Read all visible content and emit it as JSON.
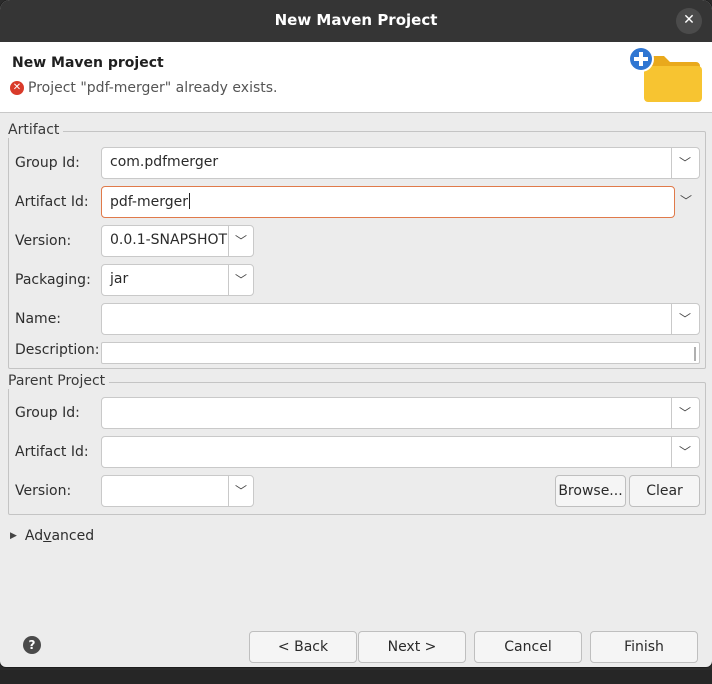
{
  "window": {
    "title": "New Maven Project",
    "close_glyph": "✕"
  },
  "header": {
    "title": "New Maven project",
    "message": "Project \"pdf-merger\" already exists.",
    "error_icon": "error-icon",
    "wizard_icon": "new-folder-icon"
  },
  "artifact": {
    "label": "Artifact",
    "group_id_label": "Group Id:",
    "group_id_value": "com.pdfmerger",
    "artifact_id_label": "Artifact Id:",
    "artifact_id_value": "pdf-merger",
    "version_label": "Version:",
    "version_value": "0.0.1-SNAPSHOT",
    "packaging_label": "Packaging:",
    "packaging_value": "jar",
    "name_label": "Name:",
    "name_value": "",
    "description_label": "Description:",
    "description_value": ""
  },
  "parent": {
    "label": "Parent Project",
    "group_id_label": "Group Id:",
    "group_id_value": "",
    "artifact_id_label": "Artifact Id:",
    "artifact_id_value": "",
    "version_label": "Version:",
    "version_value": "",
    "browse_label": "Browse...",
    "clear_label": "Clear"
  },
  "advanced": {
    "label_pre": "Ad",
    "label_underlined": "v",
    "label_post": "anced"
  },
  "footer": {
    "help_glyph": "?",
    "back_label": "< Back",
    "next_label": "Next >",
    "cancel_label": "Cancel",
    "finish_label": "Finish"
  },
  "colors": {
    "titlebar": "#353535",
    "focus_border": "#e07a4a",
    "error": "#d93b2a",
    "folder": "#f7c431",
    "plus": "#2f76d2"
  }
}
